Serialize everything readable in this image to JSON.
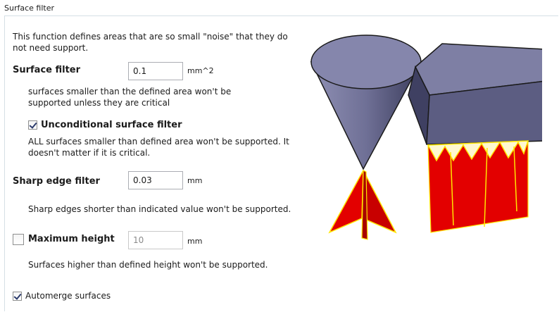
{
  "group": {
    "title": "Surface filter"
  },
  "intro": "This function defines areas that are so small \"noise\" that they do not need support.",
  "surface_filter": {
    "label": "Surface filter",
    "value": "0.1",
    "unit": "mm^2",
    "desc": "surfaces smaller than the defined area won't be supported unless they are critical"
  },
  "unconditional": {
    "label": "Unconditional surface filter",
    "checked": true,
    "desc": "ALL surfaces smaller than defined area won't be supported. It doesn't matter if it is critical."
  },
  "sharp_edge": {
    "label": "Sharp edge filter",
    "value": "0.03",
    "unit": "mm",
    "desc": "Sharp edges shorter than indicated value won't be supported."
  },
  "max_height": {
    "label": "Maximum height",
    "checked": false,
    "value": "10",
    "unit": "mm",
    "desc": "Surfaces higher than defined height won't be supported."
  },
  "automerge": {
    "label": "Automerge surfaces",
    "checked": true
  },
  "colors": {
    "model": "#6f7096",
    "support": "#e30000",
    "support_edge": "#ffe600",
    "frame": "#d5dfe5"
  }
}
